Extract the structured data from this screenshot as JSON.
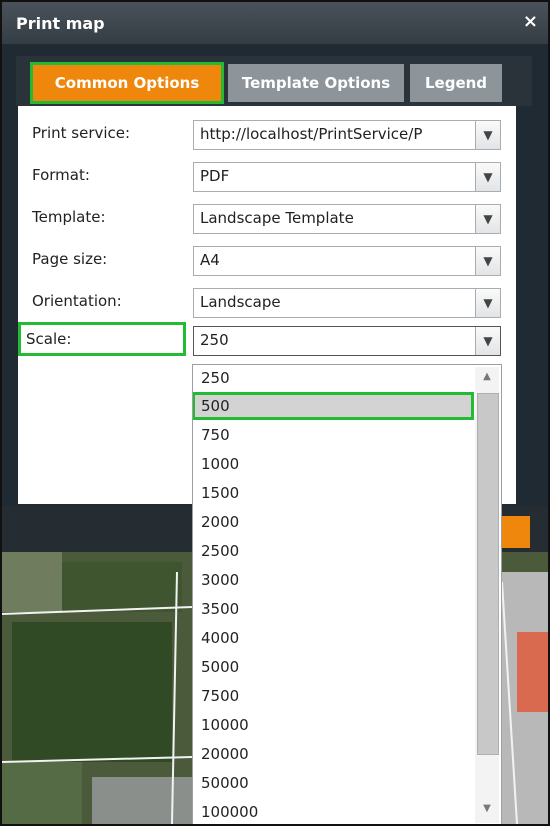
{
  "window": {
    "title": "Print map",
    "close_glyph": "×"
  },
  "tabs": [
    {
      "label": "Common Options",
      "active": true
    },
    {
      "label": "Template Options",
      "active": false
    },
    {
      "label": "Legend",
      "active": false
    }
  ],
  "form": {
    "print_service": {
      "label": "Print service:",
      "value": "http://localhost/PrintService/P"
    },
    "format": {
      "label": "Format:",
      "value": "PDF"
    },
    "template": {
      "label": "Template:",
      "value": "Landscape Template"
    },
    "page_size": {
      "label": "Page size:",
      "value": "A4"
    },
    "orientation": {
      "label": "Orientation:",
      "value": "Landscape"
    },
    "scale": {
      "label": "Scale:",
      "value": "250"
    }
  },
  "scale_options": [
    "250",
    "500",
    "750",
    "1000",
    "1500",
    "2000",
    "2500",
    "3000",
    "3500",
    "4000",
    "5000",
    "7500",
    "10000",
    "20000",
    "50000",
    "100000"
  ],
  "selected_option": "500",
  "icons": {
    "dropdown_arrow": "chevron-down-icon",
    "close": "close-icon"
  },
  "colors": {
    "accent": "#f0870d",
    "highlight": "#22bb33",
    "titlebar": "#3a4249"
  }
}
